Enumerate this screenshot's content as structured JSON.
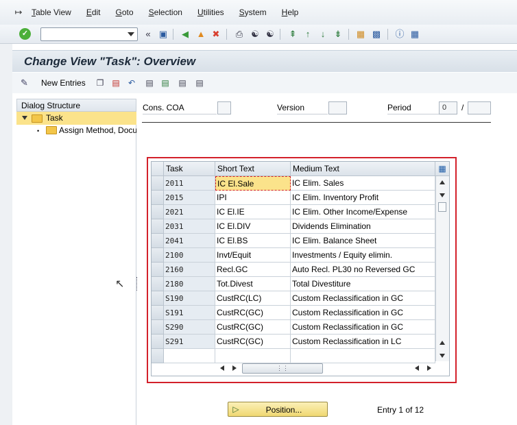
{
  "menu": {
    "items": [
      "Table View",
      "Edit",
      "Goto",
      "Selection",
      "Utilities",
      "System",
      "Help"
    ]
  },
  "toolbar": {
    "command_value": "",
    "icons": [
      "enter-icon",
      "back-double-icon",
      "save-icon",
      "back-icon",
      "exit-icon",
      "cancel-icon",
      "print-icon",
      "find-icon",
      "find-next-icon",
      "first-page-icon",
      "previous-page-icon",
      "next-page-icon",
      "last-page-icon",
      "create-session-icon",
      "shortcut-icon",
      "help-icon",
      "customize-layout-icon"
    ]
  },
  "title": "Change View \"Task\": Overview",
  "app_toolbar": {
    "new_entries": "New Entries"
  },
  "dialog_structure": {
    "header": "Dialog Structure",
    "task": "Task",
    "assign": "Assign Method, Document"
  },
  "header_fields": {
    "cons_coa_label": "Cons. COA",
    "cons_coa_value": "",
    "version_label": "Version",
    "version_value": "",
    "period_label": "Period",
    "period_value": "0",
    "period_sep": "/",
    "year_value": ""
  },
  "table": {
    "columns": [
      "Task",
      "Short Text",
      "Medium Text"
    ],
    "rows": [
      {
        "task": "2011",
        "short": "IC El.Sale",
        "medium": "IC Elim. Sales"
      },
      {
        "task": "2015",
        "short": "IPI",
        "medium": "IC Elim. Inventory Profit"
      },
      {
        "task": "2021",
        "short": "IC El.IE",
        "medium": "IC Elim. Other Income/Expense"
      },
      {
        "task": "2031",
        "short": "IC El.DIV",
        "medium": "Dividends Elimination"
      },
      {
        "task": "2041",
        "short": "IC El.BS",
        "medium": "IC Elim. Balance Sheet"
      },
      {
        "task": "2100",
        "short": "Invt/Equit",
        "medium": "Investments / Equity elimin."
      },
      {
        "task": "2160",
        "short": "Recl.GC",
        "medium": "Auto Recl. PL30 no Reversed GC"
      },
      {
        "task": "2180",
        "short": "Tot.Divest",
        "medium": "Total Divestiture"
      },
      {
        "task": "S190",
        "short": "CustRC(LC)",
        "medium": "Custom Reclassification in GC"
      },
      {
        "task": "S191",
        "short": "CustRC(GC)",
        "medium": "Custom Reclassification in GC"
      },
      {
        "task": "S290",
        "short": "CustRC(GC)",
        "medium": "Custom Reclassification in GC"
      },
      {
        "task": "S291",
        "short": "CustRC(GC)",
        "medium": "Custom Reclassification in LC"
      }
    ]
  },
  "footer": {
    "position_button": "Position...",
    "entry_info": "Entry 1 of 12"
  }
}
